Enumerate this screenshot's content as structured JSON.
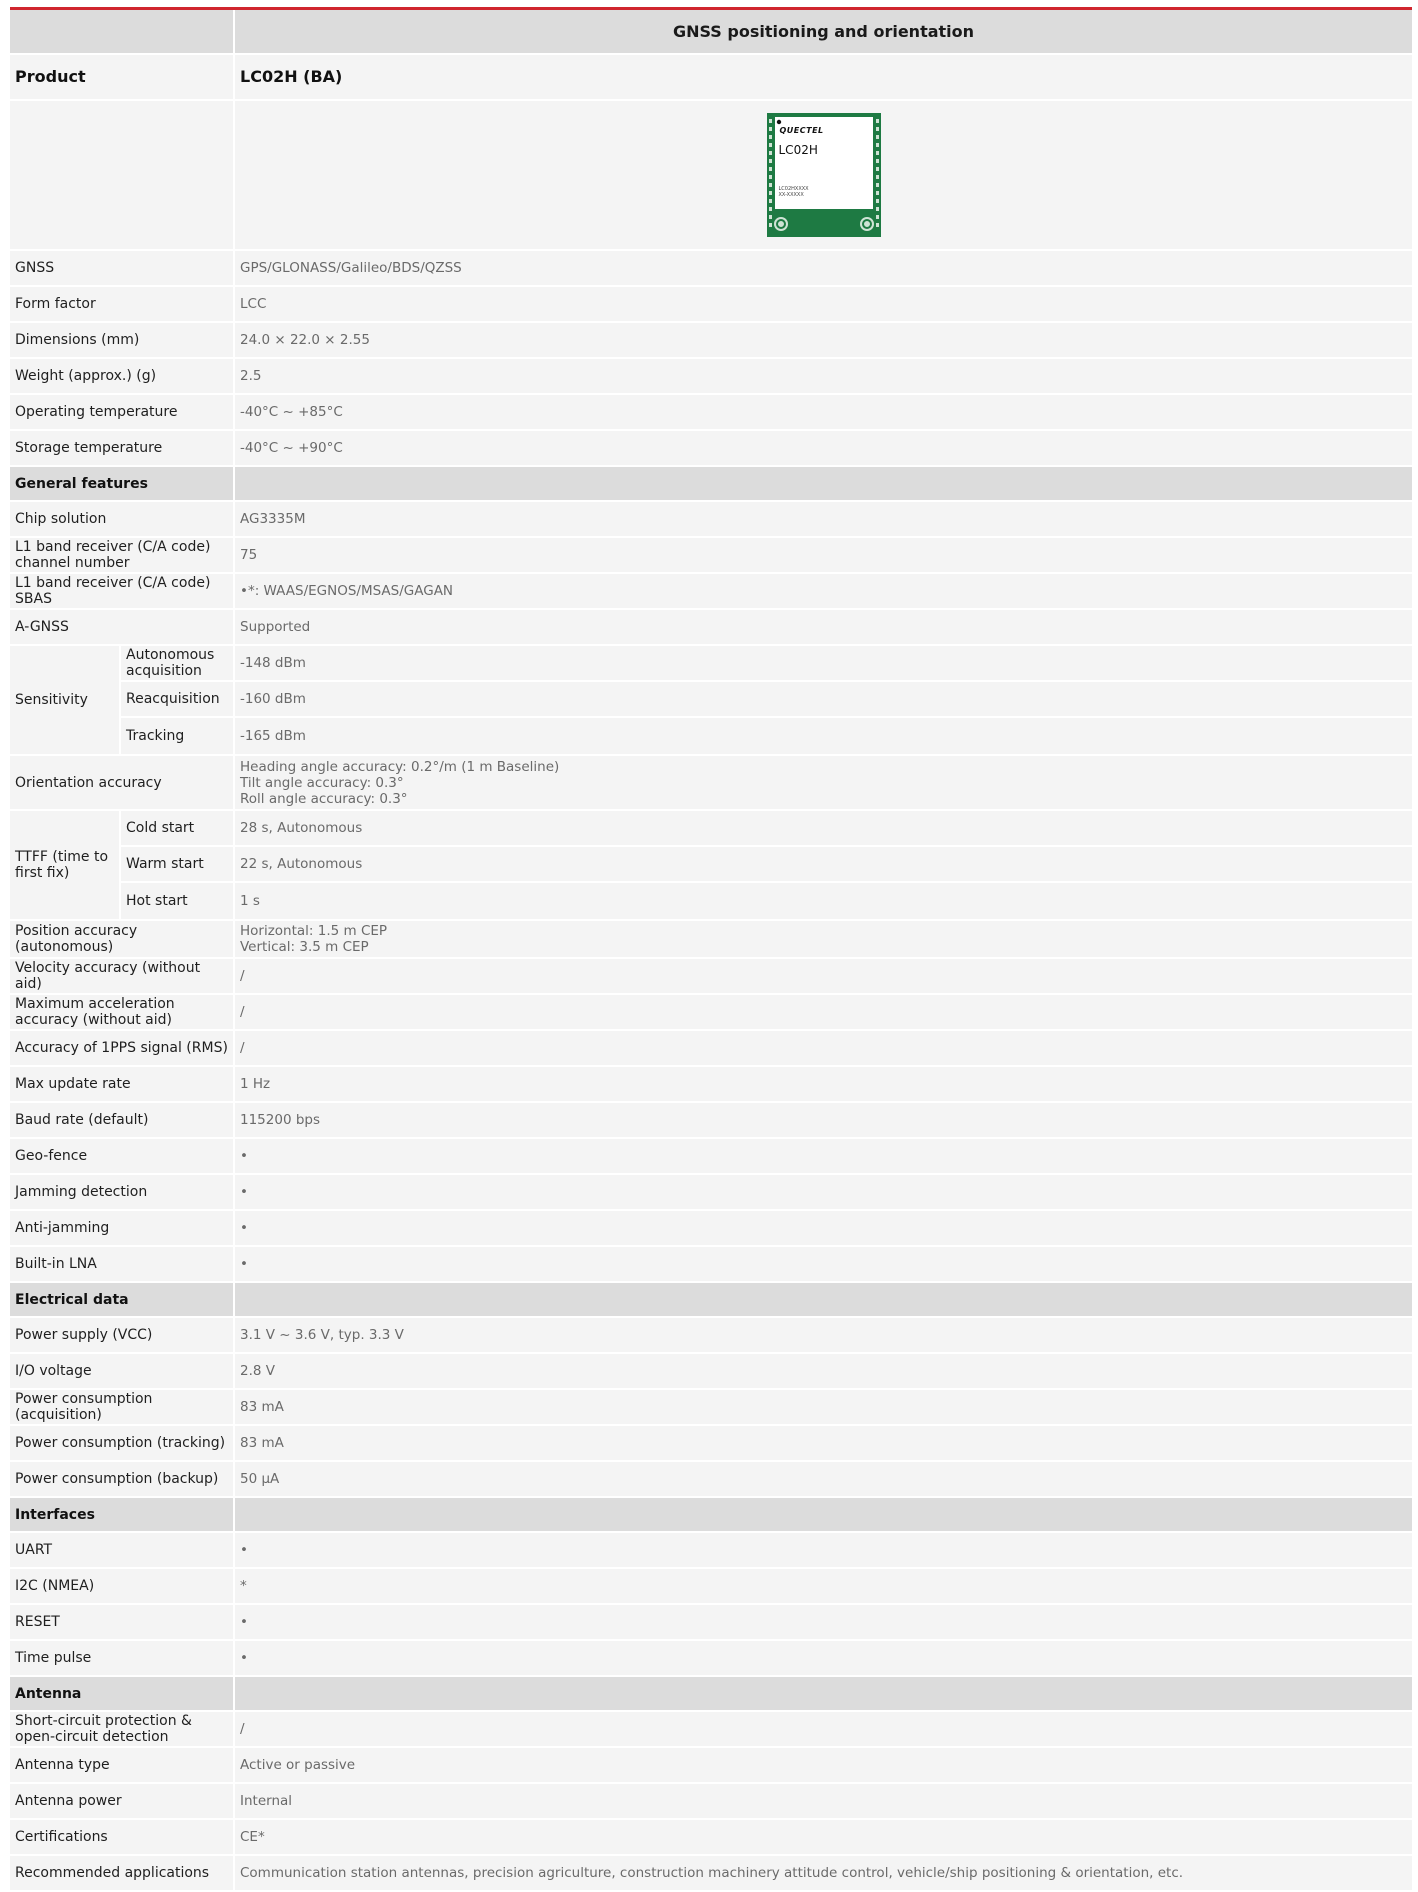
{
  "header": {
    "title": "GNSS positioning and orientation"
  },
  "product": {
    "label": "Product",
    "value": "LC02H (BA)"
  },
  "module_image": {
    "brand": "QUECTEL",
    "model": "LC02H",
    "line1": "LC02HXXXX",
    "line2": "XX-XXXXX",
    "colors": {
      "pcb": "#1e7a43",
      "shield": "#ffffff"
    }
  },
  "basic": [
    {
      "label": "GNSS",
      "value": "GPS/GLONASS/Galileo/BDS/QZSS"
    },
    {
      "label": "Form factor",
      "value": "LCC"
    },
    {
      "label": "Dimensions (mm)",
      "value": "24.0 × 22.0 × 2.55"
    },
    {
      "label": "Weight (approx.) (g)",
      "value": "2.5"
    },
    {
      "label": "Operating temperature",
      "value": "-40°C ~ +85°C"
    },
    {
      "label": "Storage temperature",
      "value": "-40°C ~ +90°C"
    }
  ],
  "general": {
    "heading": "General features",
    "rows_a": [
      {
        "label": "Chip solution",
        "value": "AG3335M"
      },
      {
        "label": "L1 band receiver (C/A code) channel number",
        "value": "75"
      },
      {
        "label": "L1 band receiver (C/A code) SBAS",
        "value": "•*: WAAS/EGNOS/MSAS/GAGAN"
      },
      {
        "label": "A-GNSS",
        "value": "Supported"
      }
    ],
    "sensitivity": {
      "label": "Sensitivity",
      "items": [
        {
          "label": "Autonomous acquisition",
          "value": "-148 dBm"
        },
        {
          "label": "Reacquisition",
          "value": "-160 dBm"
        },
        {
          "label": "Tracking",
          "value": "-165 dBm"
        }
      ]
    },
    "orientation": {
      "label": "Orientation accuracy",
      "lines": [
        "Heading angle accuracy: 0.2°/m (1 m Baseline)",
        "Tilt angle accuracy: 0.3°",
        "Roll angle accuracy: 0.3°"
      ]
    },
    "ttff": {
      "label": "TTFF (time to first fix)",
      "items": [
        {
          "label": "Cold start",
          "value": "28 s, Autonomous"
        },
        {
          "label": "Warm start",
          "value": "22 s, Autonomous"
        },
        {
          "label": "Hot start",
          "value": "1 s"
        }
      ]
    },
    "position": {
      "label": "Position accuracy (autonomous)",
      "lines": [
        "Horizontal: 1.5 m CEP",
        "Vertical: 3.5 m CEP"
      ]
    },
    "rows_b": [
      {
        "label": "Velocity accuracy (without aid)",
        "value": "/"
      },
      {
        "label": "Maximum acceleration accuracy (without aid)",
        "value": "/"
      },
      {
        "label": "Accuracy of 1PPS signal (RMS)",
        "value": "/"
      },
      {
        "label": "Max update rate",
        "value": "1 Hz"
      },
      {
        "label": "Baud rate (default)",
        "value": "115200 bps"
      },
      {
        "label": "Geo-fence",
        "value": "•"
      },
      {
        "label": "Jamming detection",
        "value": "•"
      },
      {
        "label": "Anti-jamming",
        "value": "•"
      },
      {
        "label": "Built-in LNA",
        "value": "•"
      }
    ]
  },
  "electrical": {
    "heading": "Electrical data",
    "rows": [
      {
        "label": "Power supply (VCC)",
        "value": "3.1 V ~ 3.6 V, typ. 3.3 V"
      },
      {
        "label": "I/O voltage",
        "value": "2.8 V"
      },
      {
        "label": "Power consumption (acquisition)",
        "value": "83 mA"
      },
      {
        "label": "Power consumption (tracking)",
        "value": "83 mA"
      },
      {
        "label": "Power consumption (backup)",
        "value": "50 µA"
      }
    ]
  },
  "interfaces": {
    "heading": "Interfaces",
    "rows": [
      {
        "label": "UART",
        "value": "•"
      },
      {
        "label": "I2C (NMEA)",
        "value": "*"
      },
      {
        "label": "RESET",
        "value": "•"
      },
      {
        "label": "Time pulse",
        "value": "•"
      }
    ]
  },
  "antenna": {
    "heading": "Antenna",
    "rows": [
      {
        "label": "Short-circuit protection & open-circuit detection",
        "value": "/"
      },
      {
        "label": "Antenna type",
        "value": "Active or passive"
      },
      {
        "label": "Antenna power",
        "value": "Internal"
      },
      {
        "label": "Certifications",
        "value": "CE*"
      },
      {
        "label": "Recommended applications",
        "value": "Communication station antennas, precision agriculture, construction machinery attitude control, vehicle/ship positioning & orientation, etc."
      }
    ]
  },
  "colors": {
    "accent": "#d0262e",
    "section_bg": "#dcdcdc",
    "row_bg": "#f4f4f4"
  }
}
